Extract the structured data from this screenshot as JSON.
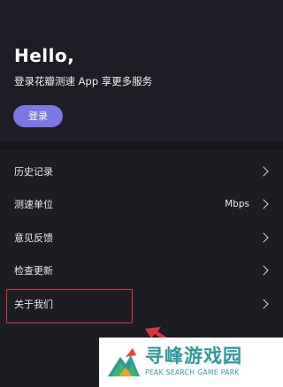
{
  "header": {
    "greeting": "Hello,",
    "subtitle": "登录花瓣测速 App 享更多服务",
    "login_label": "登录"
  },
  "menu": {
    "items": [
      {
        "label": "历史记录",
        "value": ""
      },
      {
        "label": "测速单位",
        "value": "Mbps"
      },
      {
        "label": "意见反馈",
        "value": ""
      },
      {
        "label": "检查更新",
        "value": ""
      },
      {
        "label": "关于我们",
        "value": ""
      }
    ]
  },
  "watermark": {
    "title": "寻峰游戏园",
    "subtitle": "PEAK SEARCH GAME PARK"
  },
  "colors": {
    "background": "#1c1c23",
    "accent": "#7b77e3",
    "highlight": "#d9363e",
    "watermark": "#2c9a9c"
  }
}
